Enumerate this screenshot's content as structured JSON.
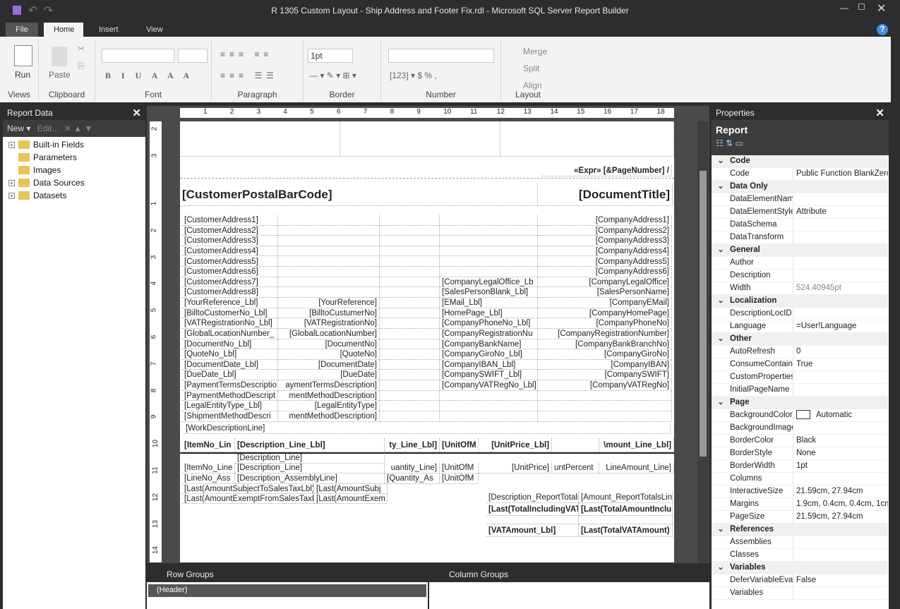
{
  "window": {
    "title": "R 1305 Custom Layout - Ship Address and Footer Fix.rdl - Microsoft SQL Server Report Builder",
    "help": "?"
  },
  "tabs": [
    "File",
    "Home",
    "Insert",
    "View"
  ],
  "ribbon": {
    "run": "Run",
    "paste": "Paste",
    "font_size": "1pt",
    "merge": "Merge",
    "split": "Split",
    "align": "Align",
    "groups": [
      "Views",
      "Clipboard",
      "Font",
      "Paragraph",
      "Border",
      "Number",
      "Layout"
    ]
  },
  "report_data": {
    "title": "Report Data",
    "new": "New",
    "edit": "Edit...",
    "items": [
      "Built-in Fields",
      "Parameters",
      "Images",
      "Data Sources",
      "Datasets"
    ]
  },
  "ruler": {
    "h": [
      "1",
      "2",
      "3",
      "4",
      "5",
      "6",
      "7",
      "8",
      "9",
      "10",
      "11",
      "12",
      "13",
      "14",
      "15",
      "16",
      "17",
      "18"
    ],
    "v_header": [
      "2",
      "3"
    ],
    "v_body": [
      "1",
      "2",
      "3",
      "4",
      "5",
      "6",
      "7",
      "8",
      "9",
      "10",
      "11",
      "12",
      "13",
      "14"
    ]
  },
  "design": {
    "page_number": "«Expr» [&PageNumber] /",
    "barcode": "[CustomerPostalBarCode]",
    "doc_title": "[DocumentTitle]",
    "rows": [
      [
        "[CustomerAddress1]",
        "",
        "",
        "[CompanyAddress1]"
      ],
      [
        "[CustomerAddress2]",
        "",
        "",
        "[CompanyAddress2]"
      ],
      [
        "[CustomerAddress3]",
        "",
        "",
        "[CompanyAddress3]"
      ],
      [
        "[CustomerAddress4]",
        "",
        "",
        "[CompanyAddress4]"
      ],
      [
        "[CustomerAddress5]",
        "",
        "",
        "[CompanyAddress5]"
      ],
      [
        "[CustomerAddress6]",
        "",
        "",
        "[CompanyAddress6]"
      ],
      [
        "[CustomerAddress7]",
        "",
        "[CompanyLegalOffice_Lb",
        "[CompanyLegalOffice]"
      ],
      [
        "[CustomerAddress8]",
        "",
        "[SalesPersonBlank_Lbl]",
        "[SalesPersonName]"
      ],
      [
        "[YourReference_Lbl]",
        "[YourReference]",
        "[EMail_Lbl]",
        "[CompanyEMail]"
      ],
      [
        "[BilltoCustomerNo_Lbl]",
        "[BilltoCustumerNo]",
        "[HomePage_Lbl]",
        "[CompanyHomePage]"
      ],
      [
        "[VATRegistrationNo_Lbl]",
        "[VATRegistrationNo]",
        "[CompanyPhoneNo_Lbl]",
        "[CompanyPhoneNo]"
      ],
      [
        "[GlobalLocationNumber_",
        "[GlobalLocationNumber]",
        "[CompanyRegistrationNu",
        "[CompanyRegistrationNumber]"
      ],
      [
        "[DocumentNo_Lbl]",
        "[DocumentNo]",
        "[CompanyBankName]",
        "[CompanyBankBranchNo]"
      ],
      [
        "[QuoteNo_Lbl]",
        "[QuoteNo]",
        "[CompanyGiroNo_Lbl]",
        "[CompanyGiroNo]"
      ],
      [
        "[DocumentDate_Lbl]",
        "[DocumentDate]",
        "[CompanyIBAN_Lbl]",
        "[CompanyIBAN]"
      ],
      [
        "[DueDate_Lbl]",
        "[DueDate]",
        "[CompanySWIFT_Lbl]",
        "[CompanySWIFT]"
      ],
      [
        "[PaymentTermsDescriptio",
        "aymentTermsDescription]",
        "[CompanyVATRegNo_Lbl]",
        "[CompanyVATRegNo]"
      ],
      [
        "[PaymentMethodDescript",
        "mentMethodDescription]",
        "",
        ""
      ],
      [
        "[LegalEntityType_Lbl]",
        "[LegalEntityType]",
        "",
        ""
      ],
      [
        "[ShipmentMethodDescri",
        "mentMethodDescription]",
        "",
        ""
      ]
    ],
    "work_description": "[WorkDescriptionLine]",
    "lines_header": [
      "[ItemNo_Lin",
      "[Description_Line_Lbl]",
      "ty_Line_Lbl]",
      "[UnitOfM",
      "[UnitPrice_Lbl]",
      "",
      "\\mount_Line_Lbl]"
    ],
    "lines_desc": "[Description_Line]",
    "lines_row": [
      "[ItemNo_Line",
      "[Description_Line]",
      "uantity_Line]",
      "[UnitOfM",
      "[UnitPrice]",
      "untPercent",
      "LineAmount_Line]"
    ],
    "lines_assembly": [
      "[LineNo_Ass",
      "[Description_AssemblyLine]",
      "[Quantity_As",
      "[UnitOfM"
    ],
    "tax": [
      [
        "[Last(AmountSubjectToSalesTaxLbl)]",
        "[Last(AmountSubj"
      ],
      [
        "[Last(AmountExemptFromSalesTaxL",
        "[Last(AmountExem"
      ]
    ],
    "totals": [
      [
        "[Description_ReportTotalsL",
        "[Amount_ReportTotalsLine]"
      ],
      [
        "[Last(TotalIncludingVAT",
        "[Last(TotalAmountInclu"
      ],
      [
        "",
        ""
      ],
      [
        "[VATAmount_Lbl]",
        "[Last(TotalVATAmount)"
      ]
    ]
  },
  "groups": {
    "row": "Row Groups",
    "column": "Column Groups",
    "header": "(Header)"
  },
  "properties": {
    "title": "Properties",
    "object": "Report",
    "rows": [
      {
        "cat": "Code"
      },
      {
        "n": "Code",
        "v": "Public Function BlankZero"
      },
      {
        "cat": "Data Only"
      },
      {
        "n": "DataElementName",
        "v": ""
      },
      {
        "n": "DataElementStyle",
        "v": "Attribute"
      },
      {
        "n": "DataSchema",
        "v": ""
      },
      {
        "n": "DataTransform",
        "v": ""
      },
      {
        "cat": "General"
      },
      {
        "n": "Author",
        "v": ""
      },
      {
        "n": "Description",
        "v": ""
      },
      {
        "n": "Width",
        "v": "524.40945pt",
        "dim": true
      },
      {
        "cat": "Localization"
      },
      {
        "n": "DescriptionLocID",
        "v": ""
      },
      {
        "n": "Language",
        "v": "=User!Language"
      },
      {
        "cat": "Other"
      },
      {
        "n": "AutoRefresh",
        "v": "0"
      },
      {
        "n": "ConsumeContainerWhitespace",
        "v": "True"
      },
      {
        "n": "CustomProperties",
        "v": ""
      },
      {
        "n": "InitialPageName",
        "v": ""
      },
      {
        "cat": "Page"
      },
      {
        "n": "BackgroundColor",
        "v": "Automatic",
        "swatch": true
      },
      {
        "n": "BackgroundImage",
        "v": ""
      },
      {
        "n": "BorderColor",
        "v": "Black"
      },
      {
        "n": "BorderStyle",
        "v": "None"
      },
      {
        "n": "BorderWidth",
        "v": "1pt"
      },
      {
        "n": "Columns",
        "v": ""
      },
      {
        "n": "InteractiveSize",
        "v": "21.59cm, 27.94cm"
      },
      {
        "n": "Margins",
        "v": "1.9cm, 0.4cm, 0.4cm, 1cm"
      },
      {
        "n": "PageSize",
        "v": "21.59cm, 27.94cm"
      },
      {
        "cat": "References"
      },
      {
        "n": "Assemblies",
        "v": ""
      },
      {
        "n": "Classes",
        "v": ""
      },
      {
        "cat": "Variables"
      },
      {
        "n": "DeferVariableEvaluation",
        "v": "False"
      },
      {
        "n": "Variables",
        "v": ""
      }
    ]
  },
  "colors": {
    "chrome": "#2d2d30",
    "ribbon": "#f3f3f3",
    "save_icon": "#9b6fd6"
  }
}
